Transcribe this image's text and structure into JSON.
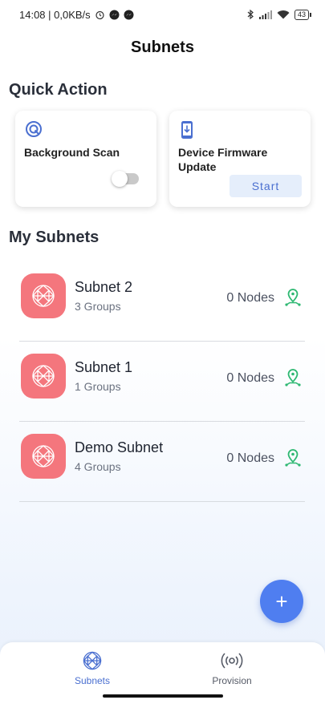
{
  "status_bar": {
    "time_info": "14:08 | 0,0KB/s",
    "battery": "43"
  },
  "header": {
    "title": "Subnets"
  },
  "quick_action": {
    "heading": "Quick Action",
    "background_scan": {
      "label": "Background Scan",
      "enabled": false
    },
    "firmware_update": {
      "label": "Device Firmware Update",
      "button": "Start"
    }
  },
  "my_subnets": {
    "heading": "My Subnets",
    "items": [
      {
        "name": "Subnet 2",
        "groups": "3 Groups",
        "nodes": "0 Nodes"
      },
      {
        "name": "Subnet 1",
        "groups": "1 Groups",
        "nodes": "0 Nodes"
      },
      {
        "name": "Demo Subnet",
        "groups": "4 Groups",
        "nodes": "0 Nodes"
      }
    ]
  },
  "fab": {
    "label": "+"
  },
  "bottom_nav": {
    "items": [
      {
        "label": "Subnets",
        "active": true,
        "color": "#4a6fd0"
      },
      {
        "label": "Provision",
        "active": false,
        "color": "#555a66"
      }
    ]
  },
  "colors": {
    "accent": "#4f7ef0",
    "subnet_avatar": "#f4767d",
    "pin": "#2eb872"
  }
}
